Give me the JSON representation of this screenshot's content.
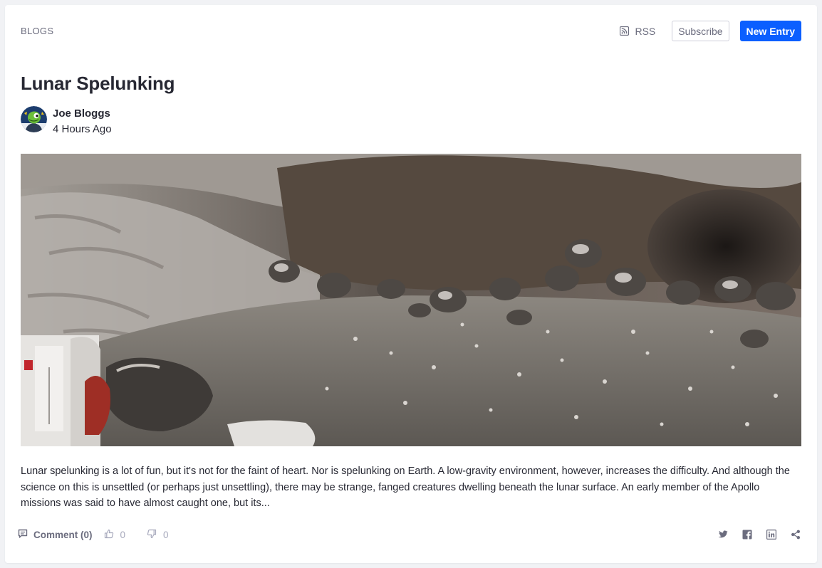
{
  "header": {
    "section_label": "BLOGS",
    "rss_label": "RSS",
    "subscribe_label": "Subscribe",
    "new_entry_label": "New Entry"
  },
  "entry": {
    "title": "Lunar Spelunking",
    "author_name": "Joe Bloggs",
    "time_ago": "4 Hours Ago",
    "excerpt": "Lunar spelunking is a lot of fun, but it's not for the faint of heart. Nor is spelunking on Earth. A low-gravity environment, however, increases the difficulty. And although the science on this is unsettled (or perhaps just unsettling), there may be strange, fanged creatures dwelling beneath the lunar surface. An early member of the Apollo missions was said to have almost caught one, but its..."
  },
  "footer": {
    "comment_label": "Comment (0)",
    "thumbs_up_count": "0",
    "thumbs_down_count": "0"
  },
  "colors": {
    "primary": "#0b5fff",
    "text": "#272833",
    "muted": "#6b6c7e",
    "background": "#f1f2f5"
  },
  "icons": {
    "rss": "rss-icon",
    "comment": "comment-icon",
    "thumbs_up": "thumbs-up-icon",
    "thumbs_down": "thumbs-down-icon",
    "twitter": "twitter-icon",
    "facebook": "facebook-icon",
    "linkedin": "linkedin-icon",
    "share": "share-icon"
  }
}
